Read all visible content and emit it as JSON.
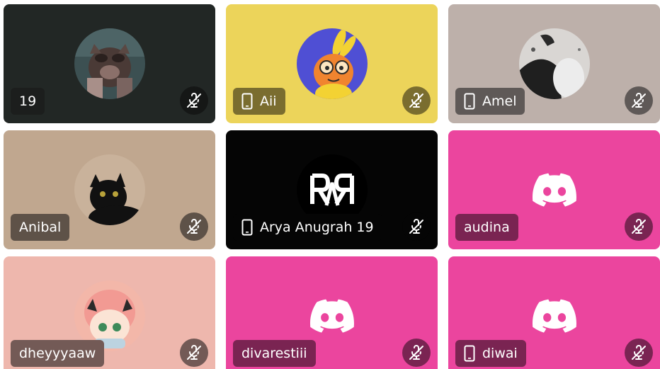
{
  "participants": [
    {
      "name": "19",
      "mobile": false,
      "avatar": "raccoon-avatar",
      "bg": "#222725",
      "pill_bg": "#1c1e1d",
      "mute_bg": "#151716"
    },
    {
      "name": "Aii",
      "mobile": true,
      "avatar": "yellow-bunny-avatar",
      "bg": "#ecd45a",
      "pill_bg": "#7a6d2f",
      "mute_bg": "#7a6d2f"
    },
    {
      "name": "Amel",
      "mobile": true,
      "avatar": "bw-photo-avatar",
      "bg": "#bdb0aa",
      "pill_bg": "#5f5957",
      "mute_bg": "#5f5957"
    },
    {
      "name": "Anibal",
      "mobile": false,
      "avatar": "black-cat-avatar",
      "bg": "#c0a78f",
      "pill_bg": "#5e5248",
      "mute_bg": "#5e5248"
    },
    {
      "name": "Arya Anugrah 19",
      "mobile": true,
      "avatar": "rar-logo-avatar",
      "bg": "#050505",
      "pill_bg": "#050505",
      "mute_bg": "#050505"
    },
    {
      "name": "audina",
      "mobile": false,
      "avatar": "discord-default-avatar",
      "bg": "#eb459e",
      "pill_bg": "#7a2452",
      "mute_bg": "#7a2452"
    },
    {
      "name": "dheyyyaaw",
      "mobile": false,
      "avatar": "anime-girl-avatar",
      "bg": "#eeb7ad",
      "pill_bg": "#735a56",
      "mute_bg": "#735a56"
    },
    {
      "name": "divarestiii",
      "mobile": false,
      "avatar": "discord-default-avatar",
      "bg": "#eb459e",
      "pill_bg": "#7a2452",
      "mute_bg": "#7a2452"
    },
    {
      "name": "diwai",
      "mobile": true,
      "avatar": "discord-default-avatar",
      "bg": "#eb459e",
      "pill_bg": "#7a2452",
      "mute_bg": "#7a2452"
    }
  ],
  "icons": {
    "mute": "microphone-muted-icon",
    "mobile": "mobile-phone-icon"
  }
}
